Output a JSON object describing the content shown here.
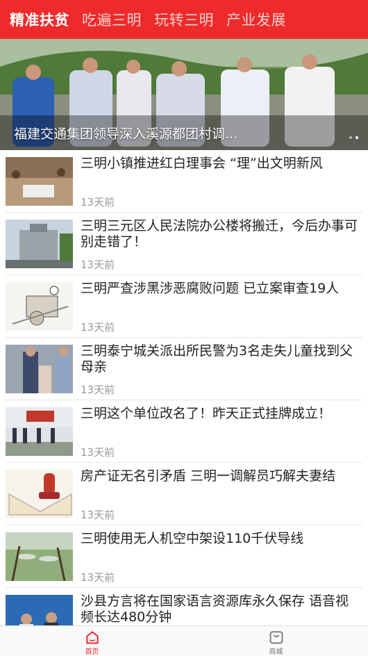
{
  "tabs": [
    {
      "label": "精准扶贫",
      "active": true
    },
    {
      "label": "吃遍三明",
      "active": false
    },
    {
      "label": "玩转三明",
      "active": false
    },
    {
      "label": "产业发展",
      "active": false
    }
  ],
  "banner": {
    "caption": "福建交通集团领导深入溪源都团村调...",
    "slide_count": 2,
    "current_slide": 2
  },
  "news": [
    {
      "title": "三明小镇推进红白理事会 “理”出文明新风",
      "time": "13天前"
    },
    {
      "title": "三明三元区人民法院办公楼将搬迁，今后办事可别走错了！",
      "time": "13天前"
    },
    {
      "title": "三明严查涉黑涉恶腐败问题 已立案审查19人",
      "time": "13天前"
    },
    {
      "title": "三明泰宁城关派出所民警为3名走失儿童找到父母亲",
      "time": "13天前"
    },
    {
      "title": "三明这个单位改名了！昨天正式挂牌成立！",
      "time": "13天前"
    },
    {
      "title": "房产证无名引矛盾 三明一调解员巧解夫妻结",
      "time": "13天前"
    },
    {
      "title": "三明使用无人机空中架设110千伏导线",
      "time": "13天前"
    },
    {
      "title": "沙县方言将在国家语言资源库永久保存 语音视频长达480分钟",
      "time": ""
    }
  ],
  "bottom_nav": {
    "home": {
      "label": "首页",
      "icon": "home-icon",
      "active": true
    },
    "shop": {
      "label": "商城",
      "icon": "shopping-bag-icon",
      "active": false
    }
  },
  "colors": {
    "accent": "#ee2a2a",
    "inactive": "#777777"
  }
}
